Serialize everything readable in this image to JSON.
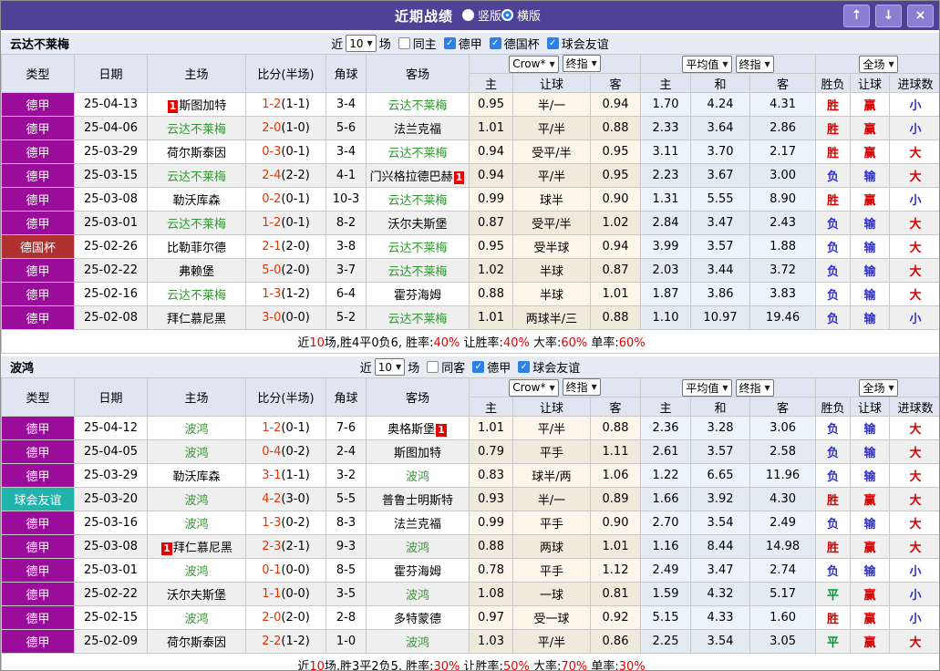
{
  "title_bar": {
    "title": "近期战绩",
    "radios": [
      {
        "label": "竖版",
        "selected": false
      },
      {
        "label": "横版",
        "selected": true
      }
    ],
    "buttons": [
      {
        "name": "move-up-button",
        "glyph": "↑"
      },
      {
        "name": "move-down-button",
        "glyph": "↓"
      },
      {
        "name": "close-button",
        "glyph": "×"
      }
    ]
  },
  "colors": {
    "title_bar_bg": "#4e4196",
    "type_league": "#9a0d9a",
    "type_cup": "#b03030",
    "type_friendly": "#1fb3ab",
    "focus_team_green": "#339933",
    "score_red": "#e83400",
    "win_red": "#d80000",
    "lose_blue": "#3030cc",
    "draw_green": "#009933",
    "summary_red": "#e60000",
    "badge_red": "#e60000",
    "checkbox_blue": "#2e7fe8"
  },
  "table_header": {
    "main_cols": [
      "类型",
      "日期",
      "主场",
      "比分(半场)",
      "角球",
      "客场"
    ],
    "sub_cols": [
      "主",
      "让球",
      "客",
      "主",
      "和",
      "客",
      "胜负",
      "让球",
      "进球数"
    ],
    "dropdown_groups": [
      [
        "Crow*",
        "终指"
      ],
      [
        "平均值",
        "终指"
      ],
      [
        "全场"
      ]
    ]
  },
  "sections": [
    {
      "team": "云达不莱梅",
      "filter": {
        "near_label": "近",
        "count": "10",
        "games_label": "场",
        "same_label": "同主",
        "same_checked": false,
        "leagues": [
          "德甲",
          "德国杯",
          "球会友谊"
        ]
      },
      "rows": [
        {
          "type": "德甲",
          "date": "25-04-13",
          "home": "斯图加特",
          "home_focus": false,
          "home_badge": "1",
          "home_badge_pos": "pre",
          "score": "1-2",
          "half": "(1-1)",
          "corners": "3-4",
          "away": "云达不莱梅",
          "away_focus": true,
          "away_badge": "",
          "away_badge_pos": "",
          "crow": [
            "0.95",
            "半/一",
            "0.94"
          ],
          "avg": [
            "1.70",
            "4.24",
            "4.31"
          ],
          "result": [
            "胜",
            "赢",
            "小"
          ]
        },
        {
          "type": "德甲",
          "date": "25-04-06",
          "home": "云达不莱梅",
          "home_focus": true,
          "home_badge": "",
          "home_badge_pos": "",
          "score": "2-0",
          "half": "(1-0)",
          "corners": "5-6",
          "away": "法兰克福",
          "away_focus": false,
          "away_badge": "",
          "away_badge_pos": "",
          "crow": [
            "1.01",
            "平/半",
            "0.88"
          ],
          "avg": [
            "2.33",
            "3.64",
            "2.86"
          ],
          "result": [
            "胜",
            "赢",
            "小"
          ]
        },
        {
          "type": "德甲",
          "date": "25-03-29",
          "home": "荷尔斯泰因",
          "home_focus": false,
          "home_badge": "",
          "home_badge_pos": "",
          "score": "0-3",
          "half": "(0-1)",
          "corners": "3-4",
          "away": "云达不莱梅",
          "away_focus": true,
          "away_badge": "",
          "away_badge_pos": "",
          "crow": [
            "0.94",
            "受平/半",
            "0.95"
          ],
          "avg": [
            "3.11",
            "3.70",
            "2.17"
          ],
          "result": [
            "胜",
            "赢",
            "大"
          ]
        },
        {
          "type": "德甲",
          "date": "25-03-15",
          "home": "云达不莱梅",
          "home_focus": true,
          "home_badge": "",
          "home_badge_pos": "",
          "score": "2-4",
          "half": "(2-2)",
          "corners": "4-1",
          "away": "门兴格拉德巴赫",
          "away_focus": false,
          "away_badge": "1",
          "away_badge_pos": "post",
          "crow": [
            "0.94",
            "平/半",
            "0.95"
          ],
          "avg": [
            "2.23",
            "3.67",
            "3.00"
          ],
          "result": [
            "负",
            "输",
            "大"
          ]
        },
        {
          "type": "德甲",
          "date": "25-03-08",
          "home": "勒沃库森",
          "home_focus": false,
          "home_badge": "",
          "home_badge_pos": "",
          "score": "0-2",
          "half": "(0-1)",
          "corners": "10-3",
          "away": "云达不莱梅",
          "away_focus": true,
          "away_badge": "",
          "away_badge_pos": "",
          "crow": [
            "0.99",
            "球半",
            "0.90"
          ],
          "avg": [
            "1.31",
            "5.55",
            "8.90"
          ],
          "result": [
            "胜",
            "赢",
            "小"
          ]
        },
        {
          "type": "德甲",
          "date": "25-03-01",
          "home": "云达不莱梅",
          "home_focus": true,
          "home_badge": "",
          "home_badge_pos": "",
          "score": "1-2",
          "half": "(0-1)",
          "corners": "8-2",
          "away": "沃尔夫斯堡",
          "away_focus": false,
          "away_badge": "",
          "away_badge_pos": "",
          "crow": [
            "0.87",
            "受平/半",
            "1.02"
          ],
          "avg": [
            "2.84",
            "3.47",
            "2.43"
          ],
          "result": [
            "负",
            "输",
            "大"
          ]
        },
        {
          "type": "德国杯",
          "date": "25-02-26",
          "home": "比勒菲尔德",
          "home_focus": false,
          "home_badge": "",
          "home_badge_pos": "",
          "score": "2-1",
          "half": "(2-0)",
          "corners": "3-8",
          "away": "云达不莱梅",
          "away_focus": true,
          "away_badge": "",
          "away_badge_pos": "",
          "crow": [
            "0.95",
            "受半球",
            "0.94"
          ],
          "avg": [
            "3.99",
            "3.57",
            "1.88"
          ],
          "result": [
            "负",
            "输",
            "大"
          ]
        },
        {
          "type": "德甲",
          "date": "25-02-22",
          "home": "弗赖堡",
          "home_focus": false,
          "home_badge": "",
          "home_badge_pos": "",
          "score": "5-0",
          "half": "(2-0)",
          "corners": "3-7",
          "away": "云达不莱梅",
          "away_focus": true,
          "away_badge": "",
          "away_badge_pos": "",
          "crow": [
            "1.02",
            "半球",
            "0.87"
          ],
          "avg": [
            "2.03",
            "3.44",
            "3.72"
          ],
          "result": [
            "负",
            "输",
            "大"
          ]
        },
        {
          "type": "德甲",
          "date": "25-02-16",
          "home": "云达不莱梅",
          "home_focus": true,
          "home_badge": "",
          "home_badge_pos": "",
          "score": "1-3",
          "half": "(1-2)",
          "corners": "6-4",
          "away": "霍芬海姆",
          "away_focus": false,
          "away_badge": "",
          "away_badge_pos": "",
          "crow": [
            "0.88",
            "半球",
            "1.01"
          ],
          "avg": [
            "1.87",
            "3.86",
            "3.83"
          ],
          "result": [
            "负",
            "输",
            "大"
          ]
        },
        {
          "type": "德甲",
          "date": "25-02-08",
          "home": "拜仁慕尼黑",
          "home_focus": false,
          "home_badge": "",
          "home_badge_pos": "",
          "score": "3-0",
          "half": "(0-0)",
          "corners": "5-2",
          "away": "云达不莱梅",
          "away_focus": true,
          "away_badge": "",
          "away_badge_pos": "",
          "crow": [
            "1.01",
            "两球半/三",
            "0.88"
          ],
          "avg": [
            "1.10",
            "10.97",
            "19.46"
          ],
          "result": [
            "负",
            "输",
            "小"
          ]
        }
      ],
      "summary_parts": [
        {
          "text": "近"
        },
        {
          "text": "10",
          "red": true
        },
        {
          "text": "场,胜4平0负6, 胜率:"
        },
        {
          "text": "40%",
          "red": true
        },
        {
          "text": " 让胜率:"
        },
        {
          "text": "40%",
          "red": true
        },
        {
          "text": " 大率:"
        },
        {
          "text": "60%",
          "red": true
        },
        {
          "text": " 单率:"
        },
        {
          "text": "60%",
          "red": true
        }
      ]
    },
    {
      "team": "波鸿",
      "filter": {
        "near_label": "近",
        "count": "10",
        "games_label": "场",
        "same_label": "同客",
        "same_checked": false,
        "leagues": [
          "德甲",
          "球会友谊"
        ]
      },
      "rows": [
        {
          "type": "德甲",
          "date": "25-04-12",
          "home": "波鸿",
          "home_focus": true,
          "home_badge": "",
          "home_badge_pos": "",
          "score": "1-2",
          "half": "(0-1)",
          "corners": "7-6",
          "away": "奥格斯堡",
          "away_focus": false,
          "away_badge": "1",
          "away_badge_pos": "post",
          "crow": [
            "1.01",
            "平/半",
            "0.88"
          ],
          "avg": [
            "2.36",
            "3.28",
            "3.06"
          ],
          "result": [
            "负",
            "输",
            "大"
          ]
        },
        {
          "type": "德甲",
          "date": "25-04-05",
          "home": "波鸿",
          "home_focus": true,
          "home_badge": "",
          "home_badge_pos": "",
          "score": "0-4",
          "half": "(0-2)",
          "corners": "2-4",
          "away": "斯图加特",
          "away_focus": false,
          "away_badge": "",
          "away_badge_pos": "",
          "crow": [
            "0.79",
            "平手",
            "1.11"
          ],
          "avg": [
            "2.61",
            "3.57",
            "2.58"
          ],
          "result": [
            "负",
            "输",
            "大"
          ]
        },
        {
          "type": "德甲",
          "date": "25-03-29",
          "home": "勒沃库森",
          "home_focus": false,
          "home_badge": "",
          "home_badge_pos": "",
          "score": "3-1",
          "half": "(1-1)",
          "corners": "3-2",
          "away": "波鸿",
          "away_focus": true,
          "away_badge": "",
          "away_badge_pos": "",
          "crow": [
            "0.83",
            "球半/两",
            "1.06"
          ],
          "avg": [
            "1.22",
            "6.65",
            "11.96"
          ],
          "result": [
            "负",
            "输",
            "大"
          ]
        },
        {
          "type": "球会友谊",
          "date": "25-03-20",
          "home": "波鸿",
          "home_focus": true,
          "home_badge": "",
          "home_badge_pos": "",
          "score": "4-2",
          "half": "(3-0)",
          "corners": "5-5",
          "away": "普鲁士明斯特",
          "away_focus": false,
          "away_badge": "",
          "away_badge_pos": "",
          "crow": [
            "0.93",
            "半/一",
            "0.89"
          ],
          "avg": [
            "1.66",
            "3.92",
            "4.30"
          ],
          "result": [
            "胜",
            "赢",
            "大"
          ]
        },
        {
          "type": "德甲",
          "date": "25-03-16",
          "home": "波鸿",
          "home_focus": true,
          "home_badge": "",
          "home_badge_pos": "",
          "score": "1-3",
          "half": "(0-2)",
          "corners": "8-3",
          "away": "法兰克福",
          "away_focus": false,
          "away_badge": "",
          "away_badge_pos": "",
          "crow": [
            "0.99",
            "平手",
            "0.90"
          ],
          "avg": [
            "2.70",
            "3.54",
            "2.49"
          ],
          "result": [
            "负",
            "输",
            "大"
          ]
        },
        {
          "type": "德甲",
          "date": "25-03-08",
          "home": "拜仁慕尼黑",
          "home_focus": false,
          "home_badge": "1",
          "home_badge_pos": "pre",
          "score": "2-3",
          "half": "(2-1)",
          "corners": "9-3",
          "away": "波鸿",
          "away_focus": true,
          "away_badge": "",
          "away_badge_pos": "",
          "crow": [
            "0.88",
            "两球",
            "1.01"
          ],
          "avg": [
            "1.16",
            "8.44",
            "14.98"
          ],
          "result": [
            "胜",
            "赢",
            "大"
          ]
        },
        {
          "type": "德甲",
          "date": "25-03-01",
          "home": "波鸿",
          "home_focus": true,
          "home_badge": "",
          "home_badge_pos": "",
          "score": "0-1",
          "half": "(0-0)",
          "corners": "8-5",
          "away": "霍芬海姆",
          "away_focus": false,
          "away_badge": "",
          "away_badge_pos": "",
          "crow": [
            "0.78",
            "平手",
            "1.12"
          ],
          "avg": [
            "2.49",
            "3.47",
            "2.74"
          ],
          "result": [
            "负",
            "输",
            "小"
          ]
        },
        {
          "type": "德甲",
          "date": "25-02-22",
          "home": "沃尔夫斯堡",
          "home_focus": false,
          "home_badge": "",
          "home_badge_pos": "",
          "score": "1-1",
          "half": "(0-0)",
          "corners": "3-5",
          "away": "波鸿",
          "away_focus": true,
          "away_badge": "",
          "away_badge_pos": "",
          "crow": [
            "1.08",
            "一球",
            "0.81"
          ],
          "avg": [
            "1.59",
            "4.32",
            "5.17"
          ],
          "result": [
            "平",
            "赢",
            "小"
          ]
        },
        {
          "type": "德甲",
          "date": "25-02-15",
          "home": "波鸿",
          "home_focus": true,
          "home_badge": "",
          "home_badge_pos": "",
          "score": "2-0",
          "half": "(2-0)",
          "corners": "2-8",
          "away": "多特蒙德",
          "away_focus": false,
          "away_badge": "",
          "away_badge_pos": "",
          "crow": [
            "0.97",
            "受一球",
            "0.92"
          ],
          "avg": [
            "5.15",
            "4.33",
            "1.60"
          ],
          "result": [
            "胜",
            "赢",
            "小"
          ]
        },
        {
          "type": "德甲",
          "date": "25-02-09",
          "home": "荷尔斯泰因",
          "home_focus": false,
          "home_badge": "",
          "home_badge_pos": "",
          "score": "2-2",
          "half": "(1-2)",
          "corners": "1-0",
          "away": "波鸿",
          "away_focus": true,
          "away_badge": "",
          "away_badge_pos": "",
          "crow": [
            "1.03",
            "平/半",
            "0.86"
          ],
          "avg": [
            "2.25",
            "3.54",
            "3.05"
          ],
          "result": [
            "平",
            "赢",
            "大"
          ]
        }
      ],
      "summary_parts": [
        {
          "text": "近"
        },
        {
          "text": "10",
          "red": true
        },
        {
          "text": "场,胜3平2负5, 胜率:"
        },
        {
          "text": "30%",
          "red": true
        },
        {
          "text": " 让胜率:"
        },
        {
          "text": "50%",
          "red": true
        },
        {
          "text": " 大率:"
        },
        {
          "text": "70%",
          "red": true
        },
        {
          "text": " 单率:"
        },
        {
          "text": "30%",
          "red": true
        }
      ]
    }
  ]
}
